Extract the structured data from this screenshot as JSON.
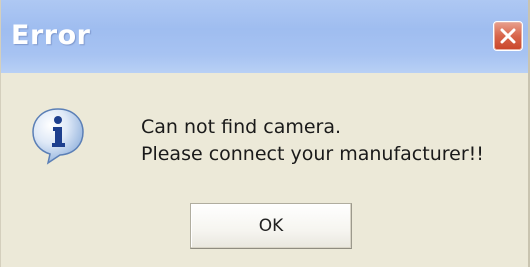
{
  "window": {
    "title": "Error",
    "close_icon": "close-icon"
  },
  "body": {
    "icon": "info-icon",
    "message_line1": "Can not find camera.",
    "message_line2": "Please connect your manufacturer!!"
  },
  "actions": {
    "ok_label": "OK"
  },
  "colors": {
    "titlebar": "#a6c2f2",
    "dialog_bg": "#ece9d8",
    "close_button": "#d8664c"
  }
}
